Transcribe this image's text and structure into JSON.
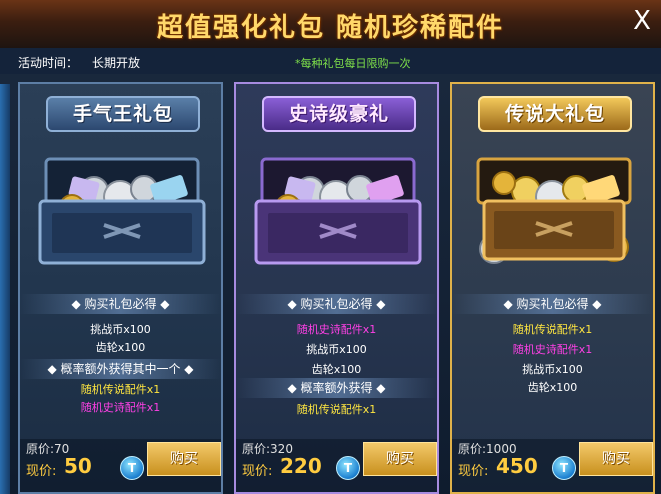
{
  "header": {
    "title": "超值强化礼包  随机珍稀配件",
    "close_label": "X"
  },
  "activity": {
    "time_label": "活动时间：",
    "time_value": "长期开放",
    "limit_note": "*每种礼包每日限购一次"
  },
  "packs": [
    {
      "name": "手气王礼包",
      "section_buy": "◆ 购买礼包必得 ◆",
      "guaranteed": [
        {
          "text": "挑战币x100",
          "color": "#ffffff"
        },
        {
          "text": "齿轮x100",
          "color": "#ffffff"
        }
      ],
      "section_chance": "◆ 概率额外获得其中一个 ◆",
      "chance": [
        {
          "text": "随机传说配件x1",
          "color": "#ffe640"
        },
        {
          "text": "随机史诗配件x1",
          "color": "#ff40e6"
        }
      ],
      "original_price": "原价:70",
      "current_label": "现价:",
      "current_price": "50",
      "ticket_icon": "T",
      "buy_label": "购买"
    },
    {
      "name": "史诗级豪礼",
      "section_buy": "◆ 购买礼包必得 ◆",
      "guaranteed": [
        {
          "text": "随机史诗配件x1",
          "color": "#ff40e6"
        },
        {
          "text": "挑战币x100",
          "color": "#ffffff"
        },
        {
          "text": "齿轮x100",
          "color": "#ffffff"
        }
      ],
      "section_chance": "◆ 概率额外获得 ◆",
      "chance": [
        {
          "text": "随机传说配件x1",
          "color": "#ffe640"
        }
      ],
      "original_price": "原价:320",
      "current_label": "现价:",
      "current_price": "220",
      "ticket_icon": "T",
      "buy_label": "购买"
    },
    {
      "name": "传说大礼包",
      "section_buy": "◆ 购买礼包必得 ◆",
      "guaranteed": [
        {
          "text": "随机传说配件x1",
          "color": "#ffe640"
        },
        {
          "text": "随机史诗配件x1",
          "color": "#ff40e6"
        },
        {
          "text": "挑战币x100",
          "color": "#ffffff"
        },
        {
          "text": "齿轮x100",
          "color": "#ffffff"
        }
      ],
      "original_price": "原价:1000",
      "current_label": "现价:",
      "current_price": "450",
      "ticket_icon": "T",
      "buy_label": "购买"
    }
  ],
  "colors": {
    "title": "#ffd86a",
    "legendary": "#ffe640",
    "epic": "#ff40e6",
    "price": "#ffcc40",
    "buy_button": "#d9a535"
  }
}
